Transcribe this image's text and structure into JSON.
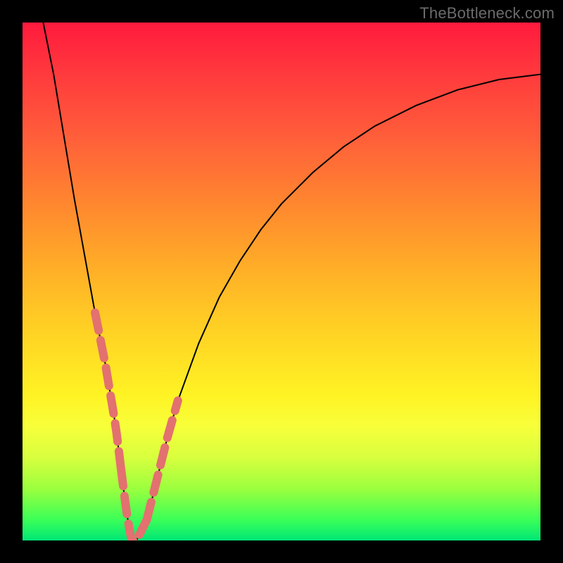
{
  "watermark": "TheBottleneck.com",
  "chart_data": {
    "type": "line",
    "title": "",
    "xlabel": "",
    "ylabel": "",
    "xlim": [
      0,
      100
    ],
    "ylim": [
      0,
      100
    ],
    "grid": false,
    "series": [
      {
        "name": "bottleneck-curve",
        "x": [
          4,
          6,
          8,
          10,
          12,
          14,
          16,
          18,
          19,
          20,
          21,
          22,
          24,
          26,
          28,
          30,
          34,
          38,
          42,
          46,
          50,
          56,
          62,
          68,
          76,
          84,
          92,
          100
        ],
        "y": [
          100,
          90,
          78,
          66,
          55,
          44,
          34,
          22,
          14,
          6,
          0,
          0,
          4,
          12,
          20,
          27,
          38,
          47,
          54,
          60,
          65,
          71,
          76,
          80,
          84,
          87,
          89,
          90
        ]
      }
    ],
    "highlight_segments": [
      {
        "name": "left-arm-dash",
        "x_range": [
          14,
          19
        ],
        "style": "dashed-pink"
      },
      {
        "name": "valley-dash",
        "x_range": [
          19,
          24
        ],
        "style": "dashed-pink"
      },
      {
        "name": "right-arm-dash",
        "x_range": [
          24,
          30
        ],
        "style": "dashed-pink"
      }
    ],
    "background_gradient": {
      "stops": [
        {
          "pos": 0.0,
          "color": "#ff1a3d"
        },
        {
          "pos": 0.36,
          "color": "#ff8a2e"
        },
        {
          "pos": 0.72,
          "color": "#fff324"
        },
        {
          "pos": 1.0,
          "color": "#00e676"
        }
      ]
    }
  }
}
